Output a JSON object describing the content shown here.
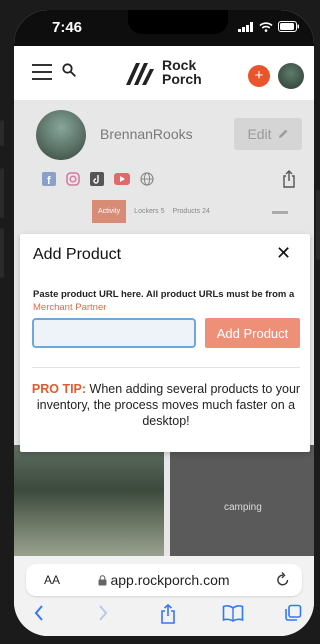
{
  "status_bar": {
    "time": "7:46"
  },
  "app": {
    "brand_line1": "Rock",
    "brand_line2": "Porch",
    "plus_label": "+"
  },
  "profile": {
    "username": "BrennanRooks",
    "edit_label": "Edit",
    "tabs": [
      {
        "label": "Activity",
        "active": true
      },
      {
        "label": "Lockers 5",
        "active": false
      },
      {
        "label": "Products 24",
        "active": false
      }
    ],
    "photo_label": "camping"
  },
  "modal": {
    "title": "Add Product",
    "close_label": "✕",
    "instruction": "Paste product URL here. All product URLs must be from a",
    "instruction_link": "Merchant Partner",
    "url_input": {
      "value": "",
      "placeholder": ""
    },
    "add_button_label": "Add Product",
    "pro_tip_label": "PRO TIP:",
    "pro_tip_text": "When adding several products to your inventory, the process moves much faster on a desktop!"
  },
  "browser": {
    "text_size_label": "AA",
    "address": "app.rockporch.com"
  },
  "colors": {
    "accent_orange": "#e8552c",
    "link_orange": "#e8674a",
    "button_salmon": "#ee9078",
    "input_border_blue": "#6fa8dc"
  }
}
